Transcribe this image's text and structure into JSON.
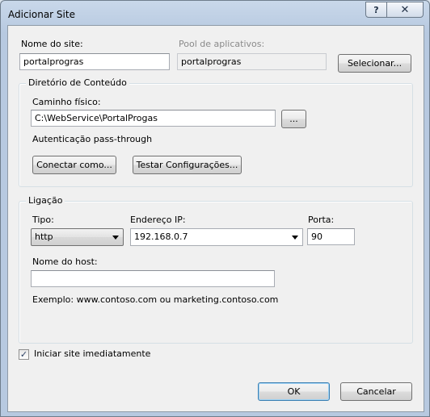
{
  "window": {
    "title": "Adicionar Site",
    "help_glyph": "?",
    "close_glyph": "✕"
  },
  "site": {
    "name_label": "Nome do site:",
    "name_value": "portalprogras",
    "pool_label": "Pool de aplicativos:",
    "pool_value": "portalprogras",
    "select_button": "Selecionar..."
  },
  "content_dir": {
    "group_label": "Diretório de Conteúdo",
    "path_label": "Caminho físico:",
    "path_value": "C:\\WebService\\PortalProgas",
    "browse_button": "...",
    "auth_text": "Autenticação pass-through",
    "connect_button": "Conectar como...",
    "test_button": "Testar Configurações..."
  },
  "binding": {
    "group_label": "Ligação",
    "type_label": "Tipo:",
    "type_value": "http",
    "ip_label": "Endereço IP:",
    "ip_value": "192.168.0.7",
    "port_label": "Porta:",
    "port_value": "90",
    "host_label": "Nome do host:",
    "host_value": "",
    "example_text": "Exemplo: www.contoso.com ou marketing.contoso.com"
  },
  "start_now": {
    "label": "Iniciar site imediatamente",
    "checked": true,
    "check_glyph": "✓"
  },
  "footer": {
    "ok": "OK",
    "cancel": "Cancelar"
  }
}
